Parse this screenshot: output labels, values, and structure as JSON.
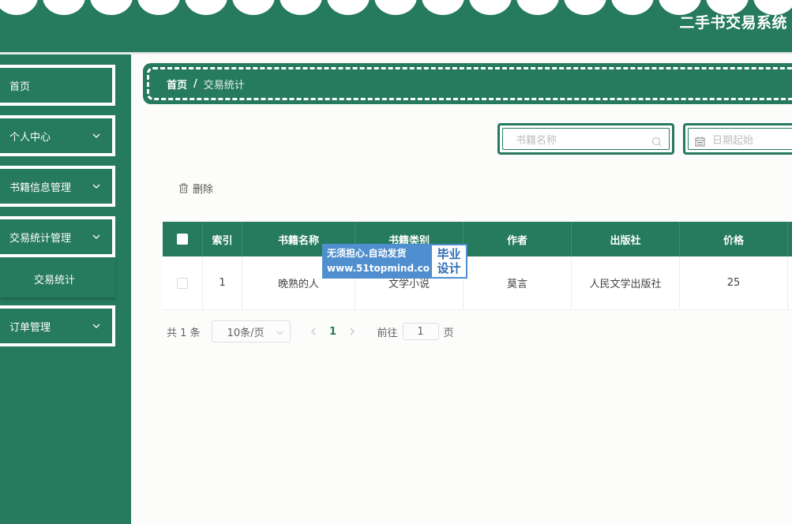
{
  "header": {
    "title": "二手书交易系统"
  },
  "sidebar": {
    "items": [
      {
        "label": "首页"
      },
      {
        "label": "个人中心"
      },
      {
        "label": "书籍信息管理"
      },
      {
        "label": "交易统计管理"
      },
      {
        "label": "订单管理"
      }
    ],
    "submenu_label": "交易统计"
  },
  "breadcrumb": {
    "home": "首页",
    "separator": "/",
    "current": "交易统计"
  },
  "search": {
    "name_placeholder": "书籍名称",
    "date_placeholder": "日期起始"
  },
  "toolbar": {
    "delete_label": "删除"
  },
  "table": {
    "columns": [
      "索引",
      "书籍名称",
      "书籍类别",
      "作者",
      "出版社",
      "价格"
    ],
    "rows": [
      {
        "index": "1",
        "name": "晚熟的人",
        "category": "文学小说",
        "author": "莫言",
        "publisher": "人民文学出版社",
        "price": "25"
      }
    ]
  },
  "watermark": {
    "line1": "无须担心.自动发货",
    "line2": "www.51topmind.com",
    "tag1": "毕业",
    "tag2": "设计"
  },
  "pagination": {
    "total": "共 1 条",
    "page_size": "10条/页",
    "current_page": "1",
    "goto_label": "前往",
    "goto_value": "1",
    "page_unit": "页"
  },
  "colors": {
    "primary": "#267a5e",
    "watermark_blue": "#4f8fcf"
  },
  "icons": {
    "search": "search-icon",
    "calendar": "calendar-icon",
    "delete": "trash-icon",
    "chevron": "chevron-down-icon"
  }
}
